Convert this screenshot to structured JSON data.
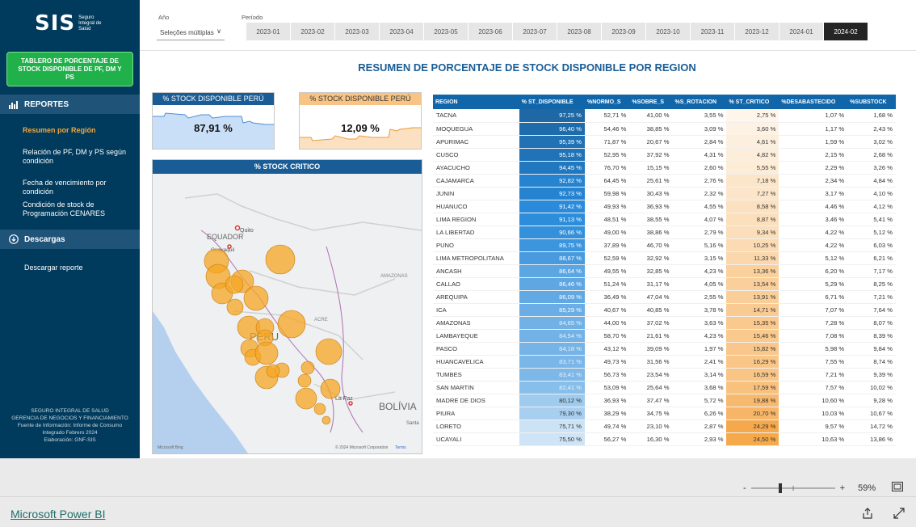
{
  "sidebar": {
    "logo": "SIS",
    "logo_sub": "Seguro Integral de Salud",
    "tablero_button": "TABLERO DE PORCENTAJE DE STOCK DISPONIBLE DE PF, DM Y PS",
    "reportes_label": "REPORTES",
    "items": [
      {
        "label": "Resumen por Región"
      },
      {
        "label": "Relación de PF, DM y PS según condición"
      },
      {
        "label": "Fecha de vencimiento por condición"
      },
      {
        "label": "Condición de stock de Programación CENARES"
      }
    ],
    "descargas_label": "Descargas",
    "descargar_label": "Descargar reporte",
    "footer": [
      "SEGURO INTEGRAL DE SALUD",
      "GERENCIA DE NEGOCIOS Y FINANCIAMIENTO",
      "Fuente de Información: Informe de Consumo",
      "Integrado Febrero 2024",
      "Elaboración: GNF-SIS"
    ]
  },
  "filters": {
    "ano_label": "Año",
    "ano_value": "Seleções múltiplas",
    "periodo_label": "Período",
    "periods": [
      "2023-01",
      "2023-02",
      "2023-03",
      "2023-04",
      "2023-05",
      "2023-06",
      "2023-07",
      "2023-08",
      "2023-09",
      "2023-10",
      "2023-11",
      "2023-12",
      "2024-01",
      "2024-02"
    ],
    "selected_period": "2024-02"
  },
  "title": "RESUMEN DE PORCENTAJE DE STOCK DISPONIBLE POR REGION",
  "kpi_peru": {
    "label": "% STOCK DISPONIBLE PERÚ",
    "value": "87,91 %"
  },
  "kpi_peru2": {
    "label": "% STOCK DISPONIBLE PERÚ",
    "value": "12,09 %"
  },
  "map": {
    "title": "% STOCK CRITICO",
    "labels": {
      "ecuador": "EQUADOR",
      "quito": "Quito",
      "guayaquil": "Guayaquil",
      "peru": "PERU",
      "amazonas": "AMAZONAS",
      "acre": "ACRE",
      "lapaz": "La Paz",
      "bolivia": "BOLÍVIA",
      "santa": "Santa",
      "bing": "Microsoft Bing",
      "copyright": "© 2024 Microsoft Corporation",
      "terms": "Terms"
    }
  },
  "table": {
    "headers": [
      "REGION",
      "% ST_DISPONIBLE",
      "%NORMO_S",
      "%SOBRE_S",
      "%S_ROTACION",
      "% ST_CRITICO",
      "%DESABASTECIDO",
      "%SUBSTOCK"
    ],
    "rows": [
      [
        "TACNA",
        "97,25 %",
        "52,71 %",
        "41,00 %",
        "3,55 %",
        "2,75 %",
        "1,07 %",
        "1,68 %"
      ],
      [
        "MOQUEGUA",
        "96,40 %",
        "54,46 %",
        "38,85 %",
        "3,09 %",
        "3,60 %",
        "1,17 %",
        "2,43 %"
      ],
      [
        "APURIMAC",
        "95,39 %",
        "71,87 %",
        "20,67 %",
        "2,84 %",
        "4,61 %",
        "1,59 %",
        "3,02 %"
      ],
      [
        "CUSCO",
        "95,18 %",
        "52,95 %",
        "37,92 %",
        "4,31 %",
        "4,82 %",
        "2,15 %",
        "2,68 %"
      ],
      [
        "AYACUCHO",
        "94,45 %",
        "76,70 %",
        "15,15 %",
        "2,60 %",
        "5,55 %",
        "2,29 %",
        "3,26 %"
      ],
      [
        "CAJAMARCA",
        "92,82 %",
        "64,45 %",
        "25,61 %",
        "2,76 %",
        "7,18 %",
        "2,34 %",
        "4,84 %"
      ],
      [
        "JUNIN",
        "92,73 %",
        "59,98 %",
        "30,43 %",
        "2,32 %",
        "7,27 %",
        "3,17 %",
        "4,10 %"
      ],
      [
        "HUANUCO",
        "91,42 %",
        "49,93 %",
        "36,93 %",
        "4,55 %",
        "8,58 %",
        "4,46 %",
        "4,12 %"
      ],
      [
        "LIMA REGION",
        "91,13 %",
        "48,51 %",
        "38,55 %",
        "4,07 %",
        "8,87 %",
        "3,46 %",
        "5,41 %"
      ],
      [
        "LA LIBERTAD",
        "90,66 %",
        "49,00 %",
        "38,86 %",
        "2,79 %",
        "9,34 %",
        "4,22 %",
        "5,12 %"
      ],
      [
        "PUNO",
        "89,75 %",
        "37,89 %",
        "46,70 %",
        "5,16 %",
        "10,25 %",
        "4,22 %",
        "6,03 %"
      ],
      [
        "LIMA METROPOLITANA",
        "88,67 %",
        "52,59 %",
        "32,92 %",
        "3,15 %",
        "11,33 %",
        "5,12 %",
        "6,21 %"
      ],
      [
        "ANCASH",
        "86,64 %",
        "49,55 %",
        "32,85 %",
        "4,23 %",
        "13,36 %",
        "6,20 %",
        "7,17 %"
      ],
      [
        "CALLAO",
        "86,46 %",
        "51,24 %",
        "31,17 %",
        "4,05 %",
        "13,54 %",
        "5,29 %",
        "8,25 %"
      ],
      [
        "AREQUIPA",
        "86,09 %",
        "36,49 %",
        "47,04 %",
        "2,55 %",
        "13,91 %",
        "6,71 %",
        "7,21 %"
      ],
      [
        "ICA",
        "85,29 %",
        "40,67 %",
        "40,85 %",
        "3,78 %",
        "14,71 %",
        "7,07 %",
        "7,64 %"
      ],
      [
        "AMAZONAS",
        "84,65 %",
        "44,00 %",
        "37,02 %",
        "3,63 %",
        "15,35 %",
        "7,28 %",
        "8,07 %"
      ],
      [
        "LAMBAYEQUE",
        "84,54 %",
        "58,70 %",
        "21,61 %",
        "4,23 %",
        "15,46 %",
        "7,08 %",
        "8,39 %"
      ],
      [
        "PASCO",
        "84,18 %",
        "43,12 %",
        "39,09 %",
        "1,97 %",
        "15,82 %",
        "5,98 %",
        "9,84 %"
      ],
      [
        "HUANCAVELICA",
        "83,71 %",
        "49,73 %",
        "31,56 %",
        "2,41 %",
        "16,29 %",
        "7,55 %",
        "8,74 %"
      ],
      [
        "TUMBES",
        "83,41 %",
        "56,73 %",
        "23,54 %",
        "3,14 %",
        "16,59 %",
        "7,21 %",
        "9,39 %"
      ],
      [
        "SAN MARTIN",
        "82,41 %",
        "53,09 %",
        "25,64 %",
        "3,68 %",
        "17,59 %",
        "7,57 %",
        "10,02 %"
      ],
      [
        "MADRE DE DIOS",
        "80,12 %",
        "36,93 %",
        "37,47 %",
        "5,72 %",
        "19,88 %",
        "10,60 %",
        "9,28 %"
      ],
      [
        "PIURA",
        "79,30 %",
        "38,29 %",
        "34,75 %",
        "6,26 %",
        "20,70 %",
        "10,03 %",
        "10,67 %"
      ],
      [
        "LORETO",
        "75,71 %",
        "49,74 %",
        "23,10 %",
        "2,87 %",
        "24,29 %",
        "9,57 %",
        "14,72 %"
      ],
      [
        "UCAYALI",
        "75,50 %",
        "56,27 %",
        "16,30 %",
        "2,93 %",
        "24,50 %",
        "10,63 %",
        "13,86 %"
      ]
    ]
  },
  "colors": {
    "blue_strong": "#1166aa",
    "orange_strong": "#f5a03c"
  },
  "bottom": {
    "zoom": "59%",
    "zoom_minus": "-",
    "zoom_plus": "+",
    "powerbi": "Microsoft Power BI"
  }
}
